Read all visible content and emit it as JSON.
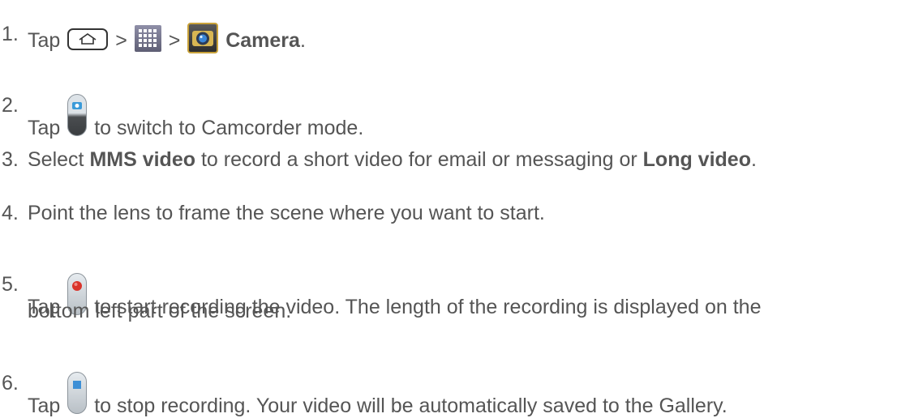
{
  "steps": [
    {
      "num": "1.",
      "pre": "Tap ",
      "sep1": " > ",
      "sep2": " > ",
      "bold": "Camera",
      "post": "."
    },
    {
      "num": "2.",
      "pre": "Tap ",
      "post": " to switch to Camcorder mode."
    },
    {
      "num": "3.",
      "pre": "Select ",
      "bold1": "MMS video",
      "mid": " to record a short video for email or messaging or ",
      "bold2": "Long video",
      "post": "."
    },
    {
      "num": "4.",
      "text": "Point the lens to frame the scene where you want to start."
    },
    {
      "num": "5.",
      "pre": "Tap ",
      "post": " to start recording the video. The length of the recording is displayed on the",
      "line2": "bottom left part of the screen."
    },
    {
      "num": "6.",
      "pre": "Tap ",
      "post": " to stop recording. Your video will be automatically saved to the Gallery."
    }
  ],
  "icons": [
    "home-key-icon",
    "apps-grid-icon",
    "camera-app-icon",
    "camcorder-switch-icon",
    "record-button-icon",
    "stop-button-icon"
  ],
  "colors": {
    "text": "#555555",
    "record_red": "#d9342b",
    "stop_blue": "#3d8fd6"
  }
}
